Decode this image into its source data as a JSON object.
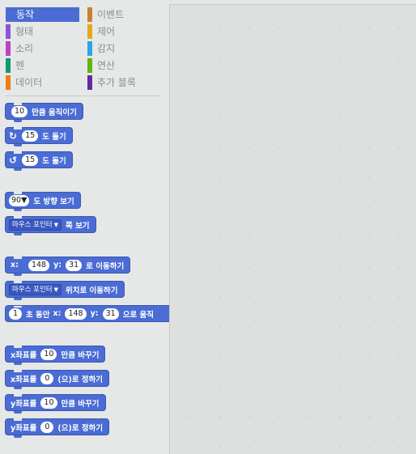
{
  "categories": [
    {
      "label": "동작",
      "color": "#4a6cd4",
      "selected": true
    },
    {
      "label": "형태",
      "color": "#8a55d7",
      "selected": false
    },
    {
      "label": "소리",
      "color": "#bb42c3",
      "selected": false
    },
    {
      "label": "펜",
      "color": "#0e9a6c",
      "selected": false
    },
    {
      "label": "데이터",
      "color": "#ee7d16",
      "selected": false
    },
    {
      "label": "이벤트",
      "color": "#c88330",
      "selected": false
    },
    {
      "label": "제어",
      "color": "#e1a91a",
      "selected": false
    },
    {
      "label": "감지",
      "color": "#2ca5e2",
      "selected": false
    },
    {
      "label": "연산",
      "color": "#5cb712",
      "selected": false
    },
    {
      "label": "추가 블록",
      "color": "#632d99",
      "selected": false
    }
  ],
  "blocks": {
    "move": {
      "value": "10",
      "text": "만큼 움직이기"
    },
    "turn_right": {
      "value": "15",
      "text": "도 돌기"
    },
    "turn_left": {
      "value": "15",
      "text": "도 돌기"
    },
    "point_dir": {
      "value": "90",
      "text": "도 방향 보기"
    },
    "point_towards": {
      "menu": "마우스 포인터",
      "text": "쪽 보기"
    },
    "goto_xy": {
      "x_label": "x:",
      "x": "148",
      "y_label": "y:",
      "y": "31",
      "text": "로 이동하기"
    },
    "goto": {
      "menu": "마우스 포인터",
      "text": "위치로 이동하기"
    },
    "glide": {
      "secs": "1",
      "t1": "초 동안",
      "x_label": "x:",
      "x": "148",
      "y_label": "y:",
      "y": "31",
      "t2": "으로 움직"
    },
    "change_x": {
      "t1": "x좌표를",
      "value": "10",
      "t2": "만큼 바꾸기"
    },
    "set_x": {
      "t1": "x좌표를",
      "value": "0",
      "t2": "(으)로 정하기"
    },
    "change_y": {
      "t1": "y좌표를",
      "value": "10",
      "t2": "만큼 바꾸기"
    },
    "set_y": {
      "t1": "y좌표를",
      "value": "0",
      "t2": "(으)로 정하기"
    }
  }
}
